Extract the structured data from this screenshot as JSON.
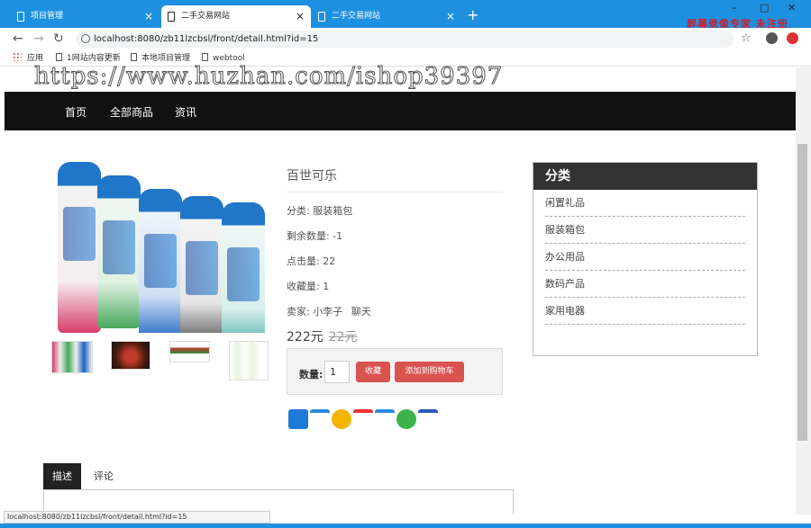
{
  "browser": {
    "tabs": [
      {
        "label": "项目管理",
        "close": "×"
      },
      {
        "label": "二手交易网站",
        "close": "×"
      },
      {
        "label": "二手交易网站",
        "close": "×"
      }
    ],
    "new_tab": "+",
    "window_controls": {
      "minimize": "–",
      "maximize": "□",
      "close": "✕"
    },
    "recorder_watermark": "屏幕录像专家 未注册",
    "url": "localhost:8080/zb11lzcbsl/front/detail.html?id=15",
    "back": "←",
    "forward": "→",
    "reload": "↻",
    "star": "☆",
    "bookmarks": [
      {
        "label": "应用"
      },
      {
        "label": "1网站内容更新"
      },
      {
        "label": "本地项目管理"
      },
      {
        "label": "webtool"
      }
    ],
    "status_url": "localhost:8080/zb11lzcbsl/front/detail.html?id=15"
  },
  "watermark": "https://www.huzhan.com/ishop39397",
  "nav": {
    "items": [
      "首页",
      "全部商品",
      "资讯"
    ]
  },
  "product": {
    "title": "百世可乐",
    "category_label": "分类: 服装箱包",
    "stock_label": "剩余数量: -1",
    "clicks_label": "点击量:  22",
    "favorites_label": "收藏量:  1",
    "seller_label": "卖家: 小李子",
    "chat_label": "聊天",
    "price": "222元",
    "old_price": "22元",
    "stars": "★★☆☆☆",
    "qty_label": "数量:",
    "qty_value": "1",
    "favorite_button": "收藏",
    "add_cart_button": "添加到购物车"
  },
  "sidebar": {
    "heading": "分类",
    "categories": [
      "闲置礼品",
      "服装箱包",
      "办公用品",
      "数码产品",
      "家用电器"
    ]
  },
  "detail_tabs": {
    "description": "描述",
    "reviews": "评论"
  },
  "colors": {
    "accent": "#1e90e0",
    "nav_bg": "#111111",
    "btn_red": "#d9534f",
    "recorder_red": "#d0202a"
  }
}
